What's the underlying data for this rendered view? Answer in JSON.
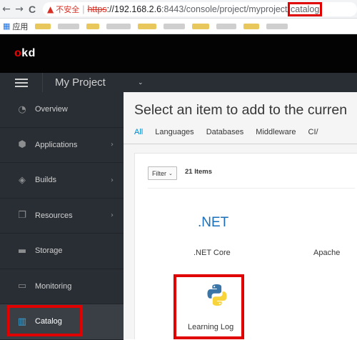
{
  "browser": {
    "nav": {
      "back": "←",
      "forward": "→",
      "reload": "C"
    },
    "warn_icon": "▲",
    "insecure_label": "不安全",
    "separator": "|",
    "url_scheme": "https",
    "url_host": "://192.168.2.6",
    "url_path": ":8443/console/project/myproject/",
    "url_highlighted": "catalog",
    "bookmarks_apps_label": "应用",
    "apps_icon": "apps-grid-icon"
  },
  "masthead": {
    "logo_prefix": "o",
    "logo_suffix": "kd"
  },
  "project": {
    "name": "My Project",
    "caret": "⌄"
  },
  "sidebar": {
    "items": [
      {
        "label": "Overview",
        "icon": "dashboard-icon",
        "glyph": "◔",
        "chevron": ""
      },
      {
        "label": "Applications",
        "icon": "cubes-icon",
        "glyph": "⬢",
        "chevron": "›"
      },
      {
        "label": "Builds",
        "icon": "layers-icon",
        "glyph": "◈",
        "chevron": "›"
      },
      {
        "label": "Resources",
        "icon": "copy-icon",
        "glyph": "❐",
        "chevron": "›"
      },
      {
        "label": "Storage",
        "icon": "hdd-icon",
        "glyph": "▬",
        "chevron": ""
      },
      {
        "label": "Monitoring",
        "icon": "desktop-icon",
        "glyph": "▭",
        "chevron": ""
      },
      {
        "label": "Catalog",
        "icon": "book-icon",
        "glyph": "▥",
        "chevron": ""
      }
    ],
    "active": "Catalog"
  },
  "main": {
    "title": "Select an item to add to the curren",
    "tabs": [
      "All",
      "Languages",
      "Databases",
      "Middleware",
      "CI/"
    ],
    "active_tab": "All",
    "filter_label": "Filter",
    "filter_caret": "⌄",
    "item_count": "21 Items",
    "tiles": [
      {
        "logo_text": ".NET",
        "label": ".NET Core"
      },
      {
        "label": "Apache"
      },
      {
        "label": "Learning Log",
        "icon": "python-icon"
      }
    ]
  },
  "colors": {
    "highlight": "#e10000",
    "accent": "#0088ce",
    "sidebar_bg": "#292e34",
    "masthead_bg": "#030303"
  }
}
